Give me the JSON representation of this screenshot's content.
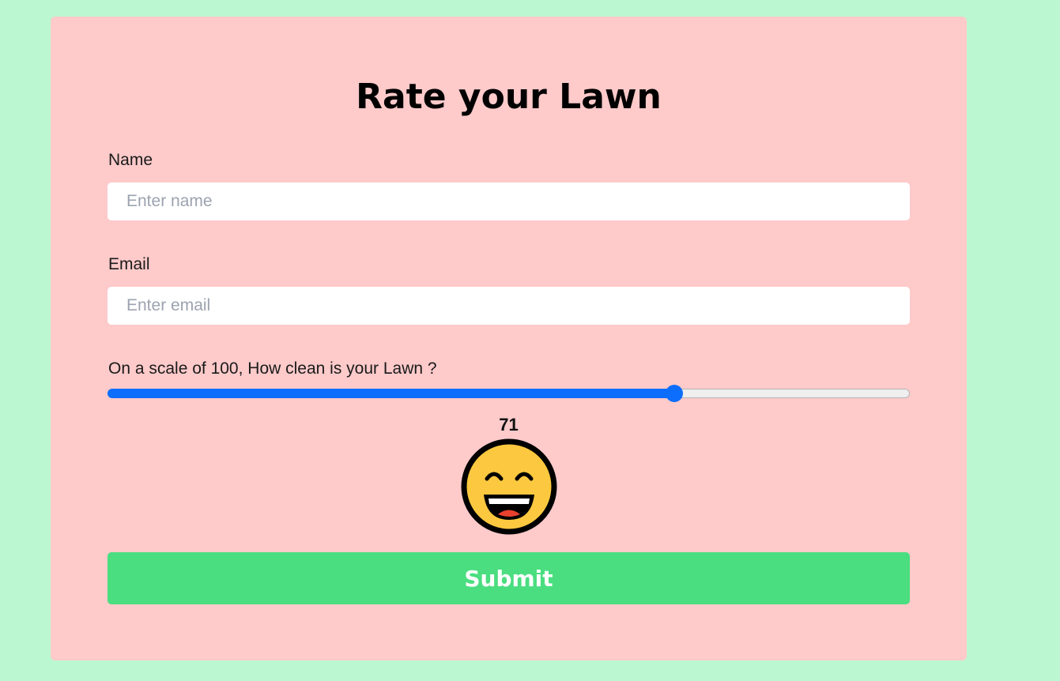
{
  "form": {
    "title": "Rate your Lawn",
    "name_label": "Name",
    "name_placeholder": "Enter name",
    "email_label": "Email",
    "email_placeholder": "Enter email",
    "scale_label": "On a scale of 100, How clean is your Lawn ?",
    "slider": {
      "value": 71,
      "min": 0,
      "max": 100
    },
    "value_display": "71",
    "emoji_icon": "grinning-face-icon",
    "submit_label": "Submit"
  },
  "colors": {
    "page_background": "#bbf7d0",
    "card_background": "#fecaca",
    "slider_accent": "#0d6efd",
    "submit_background": "#4ade80"
  }
}
